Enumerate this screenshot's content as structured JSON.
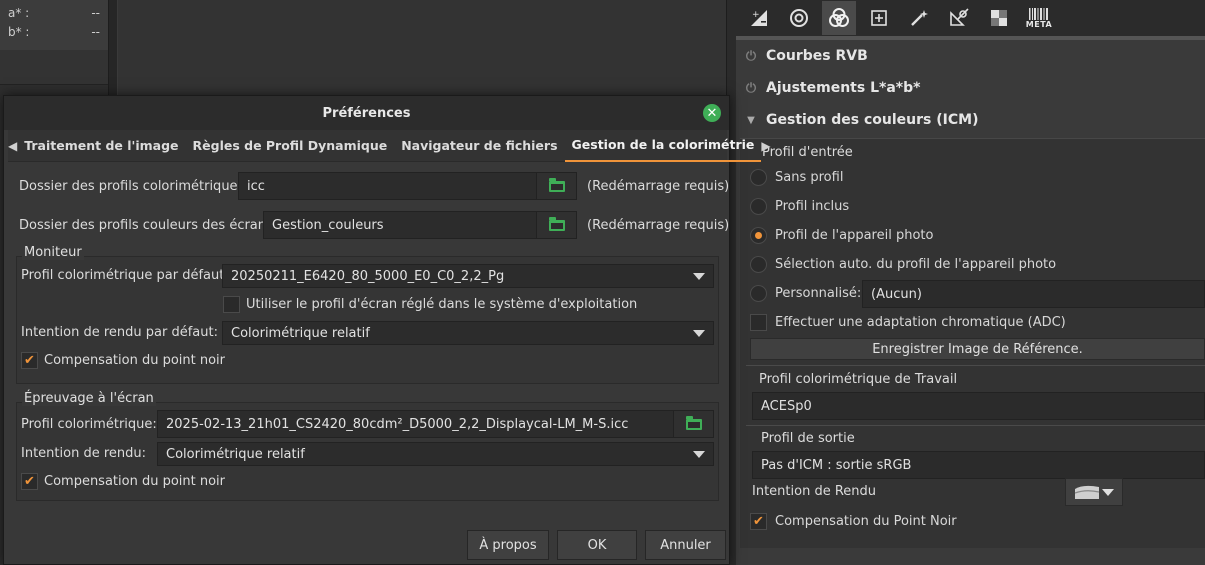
{
  "left_panel": {
    "lab": [
      {
        "label": "a* :",
        "value": "--"
      },
      {
        "label": "b* :",
        "value": "--"
      }
    ]
  },
  "toolbar": {
    "icons": [
      "exposure-icon",
      "detail-icon",
      "color-icon",
      "transform-icon",
      "wand-icon",
      "raw-icon",
      "grid-icon",
      "metadata-icon"
    ],
    "meta_label": "META"
  },
  "sections": {
    "rgb_curves": "Courbes RVB",
    "lab_adjust": "Ajustements L*a*b*",
    "icm": "Gestion des couleurs (ICM)"
  },
  "icm": {
    "input_profile_title": "Profil d'entrée",
    "options": [
      {
        "label": "Sans profil",
        "selected": false
      },
      {
        "label": "Profil inclus",
        "selected": false
      },
      {
        "label": "Profil de l'appareil photo",
        "selected": true
      },
      {
        "label": "Sélection auto. du profil de l'appareil photo",
        "selected": false
      },
      {
        "label": "Personnalisé:",
        "selected": false
      }
    ],
    "custom_value": "(Aucun)",
    "adc_label": "Effectuer une adaptation chromatique (ADC)",
    "save_ref_button": "Enregistrer Image de Référence.",
    "working_profile_title": "Profil colorimétrique de Travail",
    "working_profile_value": "ACESp0",
    "output_profile_title": "Profil de sortie",
    "output_profile_value": "Pas d'ICM : sortie sRGB",
    "intent_label": "Intention de Rendu",
    "bpc_label": "Compensation du  Point Noir"
  },
  "dialog": {
    "title": "Préférences",
    "tabs": [
      {
        "label": "Traitement de l'image",
        "active": false
      },
      {
        "label": "Règles de Profil Dynamique",
        "active": false
      },
      {
        "label": "Navigateur de fichiers",
        "active": false
      },
      {
        "label": "Gestion de la colorimétrie",
        "active": true
      }
    ],
    "color_profiles_dir_label": "Dossier des profils colorimétriques:",
    "color_profiles_dir_value": "icc",
    "screen_profiles_dir_label": "Dossier des profils couleurs des écrans:",
    "screen_profiles_dir_value": "Gestion_couleurs",
    "restart_note": "(Redémarrage requis)",
    "monitor": {
      "title": "Moniteur",
      "default_profile_label": "Profil colorimétrique par défaut:",
      "default_profile_value": "20250211_E6420_80_5000_E0_C0_2,2_Pg",
      "use_os_profile_label": "Utiliser le profil d'écran réglé dans le système d'exploitation",
      "use_os_profile_checked": false,
      "intent_label": "Intention de rendu par défaut:",
      "intent_value": "Colorimétrique relatif",
      "bpc_label": "Compensation du point noir",
      "bpc_checked": true
    },
    "proofing": {
      "title": "Épreuvage à l'écran",
      "profile_label": "Profil colorimétrique:",
      "profile_value": "2025-02-13_21h01_CS2420_80cdm²_D5000_2,2_Displaycal-LM_M-S.icc",
      "intent_label": "Intention de rendu:",
      "intent_value": "Colorimétrique relatif",
      "bpc_label": "Compensation du point noir",
      "bpc_checked": true
    },
    "buttons": {
      "about": "À propos",
      "ok": "OK",
      "cancel": "Annuler"
    }
  }
}
